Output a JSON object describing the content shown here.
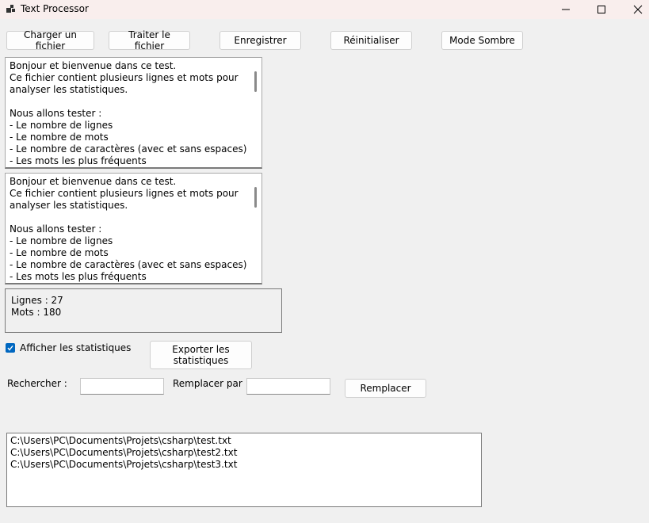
{
  "window": {
    "title": "Text Processor"
  },
  "toolbar": {
    "load": "Charger un fichier",
    "process": "Traiter le fichier",
    "save": "Enregistrer",
    "reset": "Réinitialiser",
    "dark_mode": "Mode Sombre"
  },
  "source_text": "Bonjour et bienvenue dans ce test.\nCe fichier contient plusieurs lignes et mots pour analyser les statistiques.\n\nNous allons tester :\n- Le nombre de lignes\n- Le nombre de mots\n- Le nombre de caractères (avec et sans espaces)\n- Les mots les plus fréquents",
  "result_text": "Bonjour et bienvenue dans ce test.\nCe fichier contient plusieurs lignes et mots pour analyser les statistiques.\n\nNous allons tester :\n- Le nombre de lignes\n- Le nombre de mots\n- Le nombre de caractères (avec et sans espaces)\n- Les mots les plus fréquents",
  "stats": {
    "lines": "Lignes : 27",
    "words": "Mots : 180"
  },
  "options": {
    "show_stats_label": "Afficher les statistiques",
    "show_stats_checked": true,
    "export_label": "Exporter les statistiques"
  },
  "search": {
    "search_label": "Rechercher :",
    "search_value": "",
    "replace_label": "Remplacer par",
    "replace_value": "",
    "replace_button": "Remplacer"
  },
  "recent_files": [
    "C:\\Users\\PC\\Documents\\Projets\\csharp\\test.txt",
    "C:\\Users\\PC\\Documents\\Projets\\csharp\\test2.txt",
    "C:\\Users\\PC\\Documents\\Projets\\csharp\\test3.txt"
  ],
  "colors": {
    "accent": "#0067c0",
    "titlebar": "#f9eeed",
    "window_bg": "#f0f0f0"
  }
}
